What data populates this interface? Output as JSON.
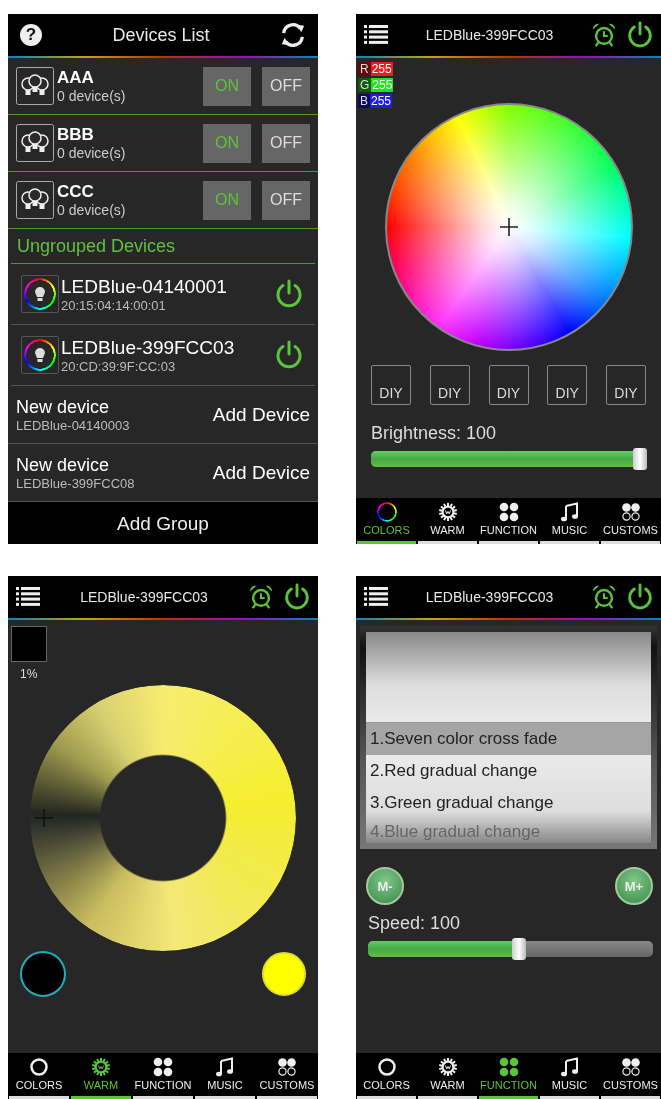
{
  "screens": [
    {
      "kind": "devices",
      "title": "Devices List",
      "help": "?",
      "groups": [
        {
          "name": "AAA",
          "count": "0 device(s)",
          "on_label": "ON",
          "off_label": "OFF"
        },
        {
          "name": "BBB",
          "count": "0 device(s)",
          "on_label": "ON",
          "off_label": "OFF"
        },
        {
          "name": "CCC",
          "count": "0 device(s)",
          "on_label": "ON",
          "off_label": "OFF"
        }
      ],
      "section": "Ungrouped Devices",
      "devices": [
        {
          "name": "LEDBlue-04140001",
          "mac": "20:15:04:14:00:01",
          "on": true
        },
        {
          "name": "LEDBlue-399FCC03",
          "mac": "20:CD:39:9F:CC:03",
          "on": true
        }
      ],
      "new_devices": [
        {
          "label": "New device",
          "id": "LEDBlue-04140003",
          "action": "Add Device"
        },
        {
          "label": "New device",
          "id": "LEDBlue-399FCC08",
          "action": "Add Device"
        }
      ],
      "footer_button": "Add Group"
    },
    {
      "kind": "colors",
      "device": "LEDBlue-399FCC03",
      "rgb": [
        {
          "channel": "R",
          "value": "255",
          "color": "#ee1c1c"
        },
        {
          "channel": "G",
          "value": "255",
          "color": "#1ee61e"
        },
        {
          "channel": "B",
          "value": "255",
          "color": "#1c1cee"
        }
      ],
      "presets": [
        "DIY",
        "DIY",
        "DIY",
        "DIY",
        "DIY"
      ],
      "slider": {
        "label": "Brightness: 100",
        "level": 1.0
      },
      "tabs": [
        {
          "label": "COLORS",
          "kind": "ring",
          "selected": true
        },
        {
          "label": "WARM",
          "kind": "sun",
          "selected": false
        },
        {
          "label": "FUNCTION",
          "kind": "grid",
          "selected": false
        },
        {
          "label": "MUSIC",
          "kind": "note",
          "selected": false
        },
        {
          "label": "CUSTOMS",
          "kind": "circles",
          "selected": false
        }
      ]
    },
    {
      "kind": "warm",
      "device": "LEDBlue-399FCC03",
      "percent": "1%",
      "endpoints": [
        {
          "color": "#000000"
        },
        {
          "color": "#ffff00"
        }
      ],
      "tabs": [
        {
          "label": "COLORS",
          "kind": "ring",
          "selected": false
        },
        {
          "label": "WARM",
          "kind": "sun",
          "selected": true
        },
        {
          "label": "FUNCTION",
          "kind": "grid",
          "selected": false
        },
        {
          "label": "MUSIC",
          "kind": "note",
          "selected": false
        },
        {
          "label": "CUSTOMS",
          "kind": "circles",
          "selected": false
        }
      ]
    },
    {
      "kind": "function",
      "device": "LEDBlue-399FCC03",
      "modes": [
        {
          "label": "1.Seven color cross fade",
          "selected": true
        },
        {
          "label": "2.Red gradual change",
          "selected": false
        },
        {
          "label": "3.Green gradual change",
          "selected": false
        },
        {
          "label": "4.Blue gradual change",
          "selected": false
        }
      ],
      "buttons": [
        "M-",
        "M+"
      ],
      "slider": {
        "label": "Speed: 100",
        "level": 0.53
      },
      "tabs": [
        {
          "label": "COLORS",
          "kind": "ring",
          "selected": false
        },
        {
          "label": "WARM",
          "kind": "sun",
          "selected": false
        },
        {
          "label": "FUNCTION",
          "kind": "grid",
          "selected": true
        },
        {
          "label": "MUSIC",
          "kind": "note",
          "selected": false
        },
        {
          "label": "CUSTOMS",
          "kind": "circles",
          "selected": false
        }
      ]
    }
  ]
}
